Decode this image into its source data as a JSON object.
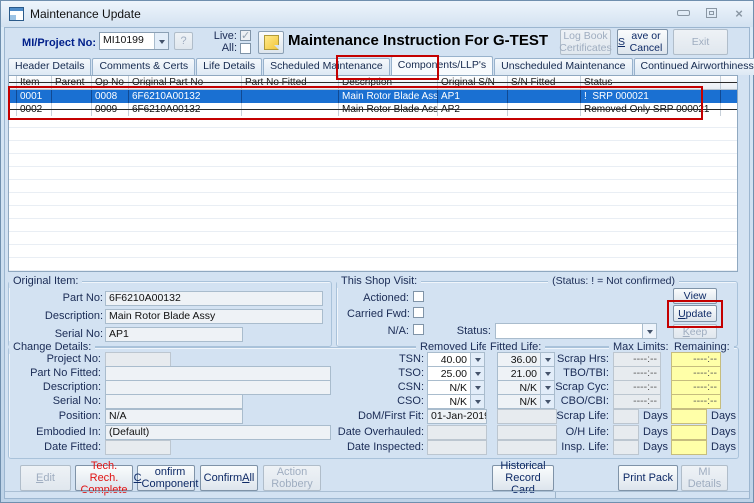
{
  "window": {
    "title": "Maintenance Update"
  },
  "toolbar": {
    "mi_label": "MI/Project No:",
    "mi_value": "MI10199",
    "help_button": "?",
    "live_label": "Live:",
    "all_label": "All:",
    "heading": "Maintenance Instruction For G-TEST",
    "logbook_button": "Log Book Certificates",
    "save_button": "Save or Cancel",
    "exit_button": "Exit"
  },
  "tabs": {
    "labels": [
      "Header Details",
      "Comments & Certs",
      "Life Details",
      "Scheduled Maintenance",
      "Components/LLP's",
      "Unscheduled Maintenance",
      "Continued Airworthiness Requirements"
    ],
    "active": "Components/LLP's"
  },
  "table": {
    "columns": [
      "Item",
      "Parent",
      "Op No",
      "Original Part No",
      "Part No Fitted",
      "Description",
      "Original S/N",
      "S/N Fitted",
      "Status"
    ],
    "rows": [
      {
        "item": "0001",
        "parent": "",
        "op_no": "0008",
        "original_part_no": "6F6210A00132",
        "part_no_fitted": "",
        "description": "Main Rotor Blade Assy",
        "original_sn": "AP1",
        "sn_fitted": "",
        "status": "!  SRP 000021"
      },
      {
        "item": "0002",
        "parent": "",
        "op_no": "0009",
        "original_part_no": "6F6210A00132",
        "part_no_fitted": "",
        "description": "Main Rotor Blade Assy",
        "original_sn": "AP2",
        "sn_fitted": "",
        "status": "Removed Only SRP 000021"
      }
    ]
  },
  "original_item": {
    "title": "Original Item:",
    "part_no_label": "Part No:",
    "part_no": "6F6210A00132",
    "description_label": "Description:",
    "description": "Main Rotor Blade Assy",
    "serial_no_label": "Serial No:",
    "serial_no": "AP1"
  },
  "shop_visit": {
    "title": "This Shop Visit:",
    "status_note": "(Status: ! = Not confirmed)",
    "actioned_label": "Actioned:",
    "carried_label": "Carried Fwd:",
    "na_label": "N/A:",
    "status_label": "Status:",
    "status_value": "",
    "view_button": "View",
    "update_button": "Update",
    "keep_button": "Keep"
  },
  "change": {
    "title": "Change Details:",
    "rows": [
      {
        "label": "Project No:",
        "value": ""
      },
      {
        "label": "Part No Fitted:",
        "value": ""
      },
      {
        "label": "Description:",
        "value": ""
      },
      {
        "label": "Serial No:",
        "value": ""
      },
      {
        "label": "Position:",
        "value": "N/A"
      },
      {
        "label": "Embodied In:",
        "value": "(Default)"
      },
      {
        "label": "Date Fitted:",
        "value": ""
      }
    ]
  },
  "life": {
    "removed_header": "Removed Life:",
    "fitted_header": "Fitted Life:",
    "max_header": "Max Limits:",
    "remaining_header": "Remaining:",
    "days": "Days",
    "rows": [
      {
        "label": "TSN:",
        "removed": "40.00",
        "fitted": "36.00",
        "max_label": "Scrap Hrs:",
        "max": "----:--",
        "rem": "----:--"
      },
      {
        "label": "TSO:",
        "removed": "25.00",
        "fitted": "21.00",
        "max_label": "TBO/TBI:",
        "max": "----:--",
        "rem": "----:--"
      },
      {
        "label": "CSN:",
        "removed": "N/K",
        "fitted": "N/K",
        "max_label": "Scrap Cyc:",
        "max": "----:--",
        "rem": "----:--"
      },
      {
        "label": "CSO:",
        "removed": "N/K",
        "fitted": "N/K",
        "max_label": "CBO/CBI:",
        "max": "----:--",
        "rem": "----:--"
      },
      {
        "label": "DoM/First Fit:",
        "removed": "01-Jan-2019",
        "fitted": "",
        "max_label": "Scrap Life:",
        "max": "",
        "rem": ""
      },
      {
        "label": "Date Overhauled:",
        "removed": "",
        "fitted": "",
        "max_label": "O/H Life:",
        "max": "",
        "rem": ""
      },
      {
        "label": "Date Inspected:",
        "removed": "",
        "fitted": "",
        "max_label": "Insp. Life:",
        "max": "",
        "rem": ""
      }
    ]
  },
  "footer": {
    "edit": "Edit",
    "tech_rech": "Tech. Rech. Complete",
    "confirm_component": "Confirm Component",
    "confirm_all": "Confirm All",
    "action_robbery": "Action Robbery",
    "historical": "Historical Record Card",
    "print_pack": "Print Pack",
    "mi_details": "MI Details"
  },
  "colors": {
    "selection_blue": "#1a70d2",
    "annotation_red": "#c40000",
    "remaining_yellow": "#ffffa8",
    "alert_red": "#e01212",
    "label_navy": "#001f8a"
  }
}
